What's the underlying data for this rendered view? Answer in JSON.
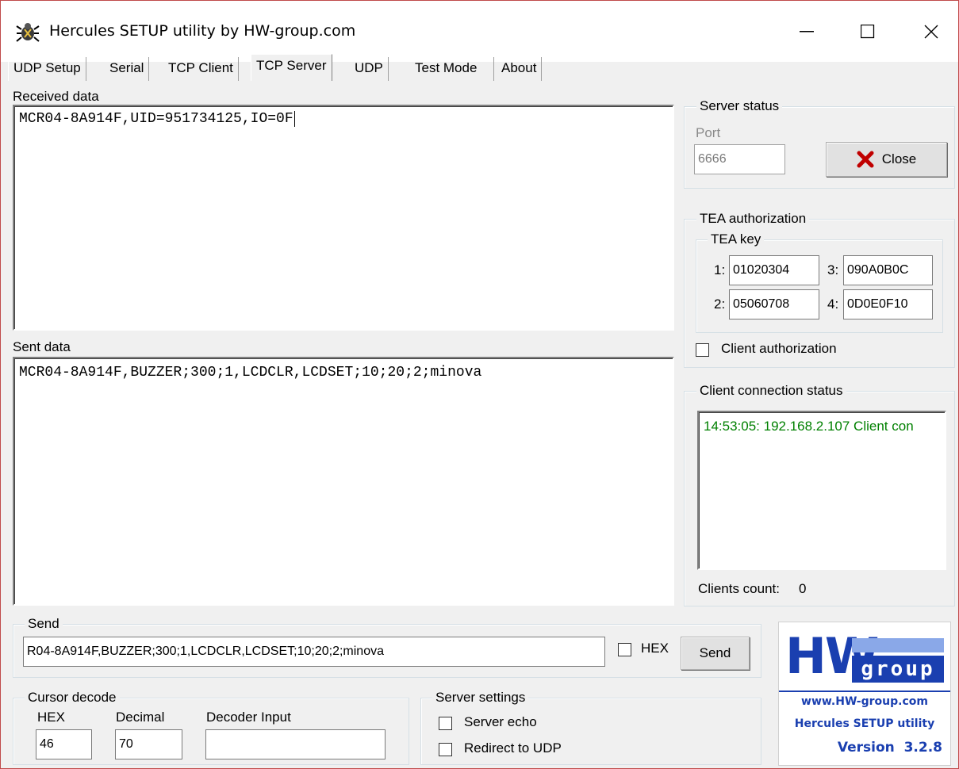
{
  "window": {
    "title": "Hercules SETUP utility by HW-group.com"
  },
  "tabs": [
    {
      "label": "UDP Setup"
    },
    {
      "label": "Serial"
    },
    {
      "label": "TCP Client"
    },
    {
      "label": "TCP Server",
      "active": true
    },
    {
      "label": "UDP"
    },
    {
      "label": "Test Mode"
    },
    {
      "label": "About"
    }
  ],
  "received": {
    "label": "Received data",
    "text": "MCR04-8A914F,UID=951734125,IO=0F"
  },
  "sent": {
    "label": "Sent data",
    "text": "MCR04-8A914F,BUZZER;300;1,LCDCLR,LCDSET;10;20;2;minova"
  },
  "server_status": {
    "title": "Server status",
    "port_label": "Port",
    "port_value": "6666",
    "close_label": "Close"
  },
  "tea": {
    "title": "TEA authorization",
    "key_title": "TEA key",
    "keys": [
      {
        "n": "1:",
        "value": "01020304"
      },
      {
        "n": "3:",
        "value": "090A0B0C"
      },
      {
        "n": "2:",
        "value": "05060708"
      },
      {
        "n": "4:",
        "value": "0D0E0F10"
      }
    ],
    "client_auth_label": "Client authorization"
  },
  "client_status": {
    "title": "Client connection status",
    "log": "14:53:05:  192.168.2.107 Client con",
    "log_color": "#008000",
    "count_label": "Clients count:",
    "count_value": "0"
  },
  "send": {
    "title": "Send",
    "input_value": "R04-8A914F,BUZZER;300;1,LCDCLR,LCDSET;10;20;2;minova",
    "hex_label": "HEX",
    "button_label": "Send"
  },
  "cursor": {
    "title": "Cursor decode",
    "hex_label": "HEX",
    "hex_value": "46",
    "dec_label": "Decimal",
    "dec_value": "70",
    "input_label": "Decoder Input",
    "input_value": ""
  },
  "server_settings": {
    "title": "Server settings",
    "echo_label": "Server echo",
    "redirect_label": "Redirect to UDP"
  },
  "logo": {
    "hw": "HW",
    "group": "group",
    "url": "www.HW-group.com",
    "product": "Hercules SETUP utility",
    "version": "Version  3.2.8",
    "brand_color": "#1a3fb0"
  }
}
